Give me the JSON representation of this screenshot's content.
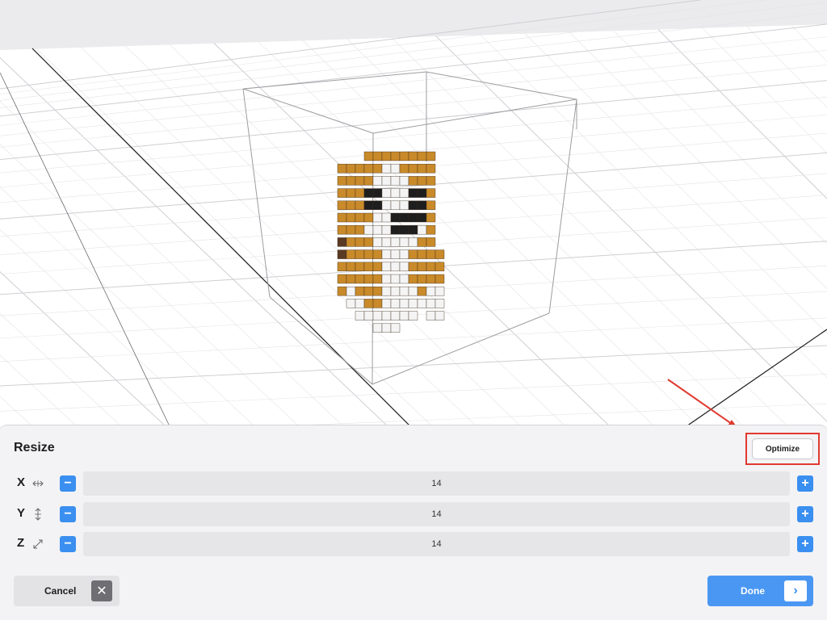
{
  "viewport": {
    "model": "voxel-dog",
    "colors": {
      "background": "#ebebed",
      "grid_line": "#d6d6da",
      "axis_line": "#111111",
      "bounding_box": "#9a9a9e",
      "fur": "#c98a2a",
      "white": "#f4f4f4",
      "black": "#1e1e1e",
      "ear_dark": "#5a3a22"
    }
  },
  "panel": {
    "title": "Resize",
    "optimize_label": "Optimize",
    "rows": [
      {
        "axis": "X",
        "icon": "resize-horizontal-icon",
        "value": "14"
      },
      {
        "axis": "Y",
        "icon": "resize-vertical-icon",
        "value": "14"
      },
      {
        "axis": "Z",
        "icon": "resize-diagonal-icon",
        "value": "14"
      }
    ],
    "minus_label": "−",
    "plus_label": "+",
    "cancel_label": "Cancel",
    "done_label": "Done",
    "accent": "#3a8ff0",
    "annotation_color": "#e03a2f"
  }
}
